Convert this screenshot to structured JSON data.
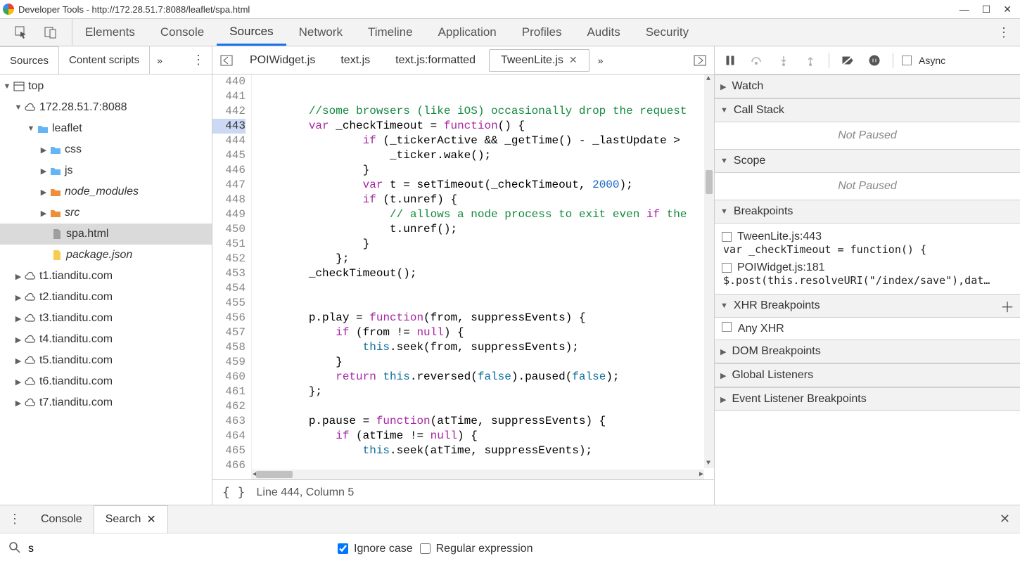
{
  "title": "Developer Tools - http://172.28.51.7:8088/leaflet/spa.html",
  "mainTabs": [
    "Elements",
    "Console",
    "Sources",
    "Network",
    "Timeline",
    "Application",
    "Profiles",
    "Audits",
    "Security"
  ],
  "mainTabActive": "Sources",
  "sidebar": {
    "tabs": [
      "Sources",
      "Content scripts"
    ],
    "active": "Sources",
    "tree": {
      "top": "top",
      "host": "172.28.51.7:8088",
      "leaflet": "leaflet",
      "css": "css",
      "js": "js",
      "node_modules": "node_modules",
      "src": "src",
      "spa": "spa.html",
      "package": "package.json",
      "t1": "t1.tianditu.com",
      "t2": "t2.tianditu.com",
      "t3": "t3.tianditu.com",
      "t4": "t4.tianditu.com",
      "t5": "t5.tianditu.com",
      "t6": "t6.tianditu.com",
      "t7": "t7.tianditu.com"
    }
  },
  "editorTabs": [
    {
      "label": "POIWidget.js",
      "active": false
    },
    {
      "label": "text.js",
      "active": false
    },
    {
      "label": "text.js:formatted",
      "active": false
    },
    {
      "label": "TweenLite.js",
      "active": true
    }
  ],
  "code": {
    "startLine": 440,
    "highlight": 443,
    "lines": [
      "",
      "",
      "        //some browsers (like iOS) occasionally drop the request",
      "        var _checkTimeout = function() {",
      "                if (_tickerActive && _getTime() - _lastUpdate >",
      "                    _ticker.wake();",
      "                }",
      "                var t = setTimeout(_checkTimeout, 2000);",
      "                if (t.unref) {",
      "                    // allows a node process to exit even if the",
      "                    t.unref();",
      "                }",
      "            };",
      "        _checkTimeout();",
      "",
      "",
      "        p.play = function(from, suppressEvents) {",
      "            if (from != null) {",
      "                this.seek(from, suppressEvents);",
      "            }",
      "            return this.reversed(false).paused(false);",
      "        };",
      "",
      "        p.pause = function(atTime, suppressEvents) {",
      "            if (atTime != null) {",
      "                this.seek(atTime, suppressEvents);",
      ""
    ]
  },
  "status": "Line 444, Column 5",
  "rightPane": {
    "asyncLabel": "Async",
    "watch": "Watch",
    "callStack": "Call Stack",
    "notPaused": "Not Paused",
    "scope": "Scope",
    "breakpoints": "Breakpoints",
    "bp1": {
      "label": "TweenLite.js:443",
      "code": "var _checkTimeout = function() {"
    },
    "bp2": {
      "label": "POIWidget.js:181",
      "code": "$.post(this.resolveURI(\"/index/save\"),dat…"
    },
    "xhr": "XHR Breakpoints",
    "anyXhr": "Any XHR",
    "dom": "DOM Breakpoints",
    "global": "Global Listeners",
    "event": "Event Listener Breakpoints"
  },
  "drawer": {
    "console": "Console",
    "search": "Search",
    "input": "s",
    "ignoreCase": "Ignore case",
    "regex": "Regular expression"
  }
}
